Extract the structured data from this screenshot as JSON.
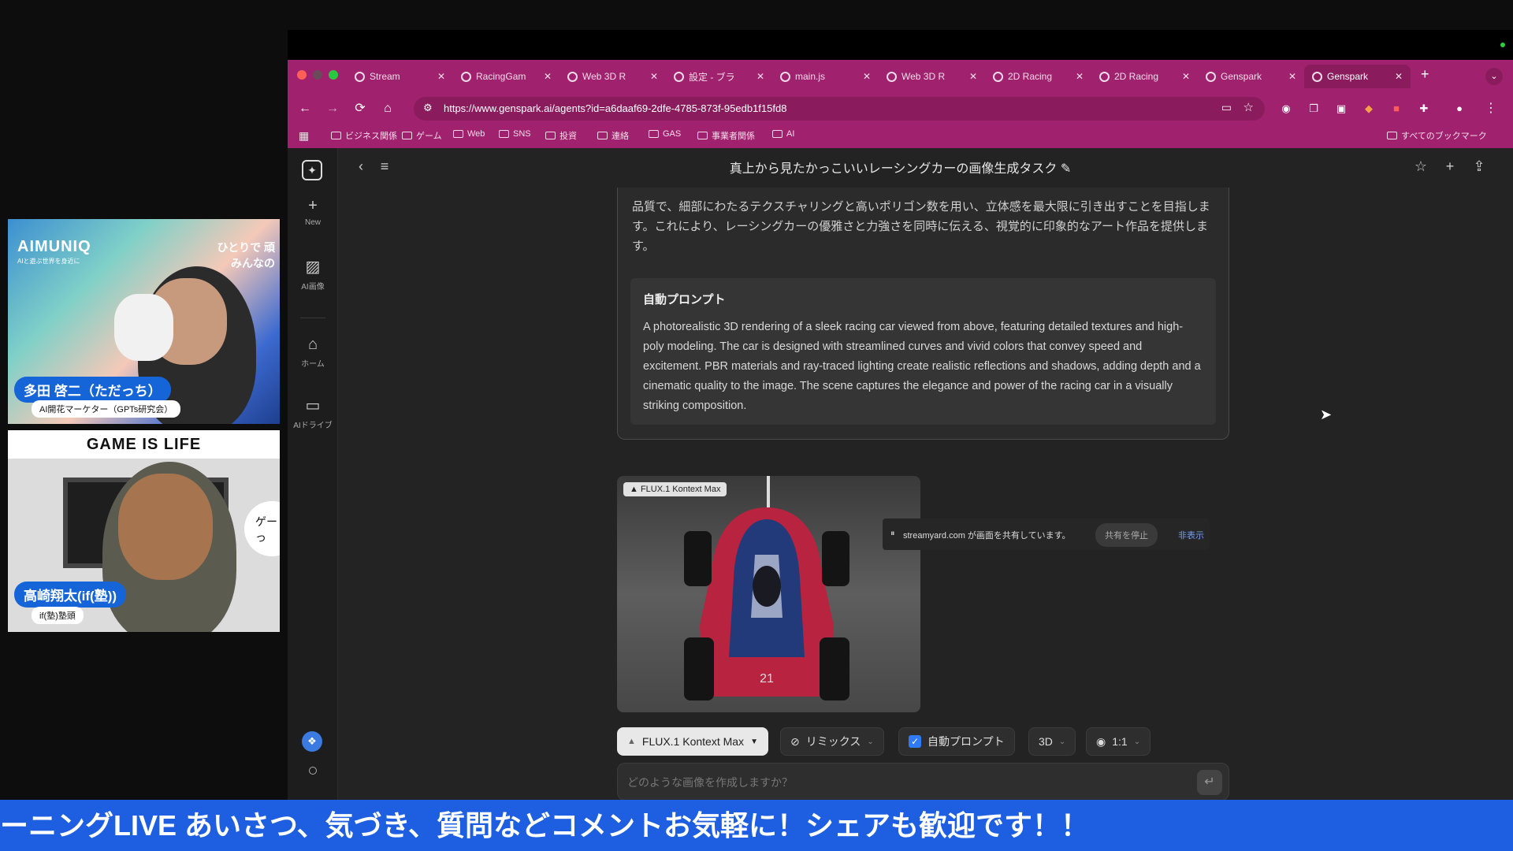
{
  "stream": {
    "cam1": {
      "brand": "AIMUNIQ",
      "brand_sub": "AIと遊ぶ世界を身近に",
      "tagline": "ひとりで 頑\nみんなの",
      "name": "多田 啓二（ただっち）",
      "role": "AI開花マーケター（GPTs研究会）"
    },
    "cam2": {
      "banner": "GAME IS LIFE",
      "speech": "ゲー 作っ",
      "name": "高崎翔太(if(塾))",
      "role": "if(塾)塾頭"
    },
    "ticker": "ーニングLIVE あいさつ、気づき、質問などコメントお気軽に！シェアも歓迎です！！"
  },
  "browser": {
    "tabs": [
      {
        "label": "Stream"
      },
      {
        "label": "RacingGam"
      },
      {
        "label": "Web 3D R"
      },
      {
        "label": "設定 - ブラ"
      },
      {
        "label": "main.js"
      },
      {
        "label": "Web 3D R"
      },
      {
        "label": "2D Racing"
      },
      {
        "label": "2D Racing"
      },
      {
        "label": "Genspark"
      },
      {
        "label": "Genspark"
      }
    ],
    "url": "https://www.genspark.ai/agents?id=a6daaf69-2dfe-4785-873f-95edb1f15fd8",
    "bookmarks": [
      "ビジネス関係",
      "ゲーム",
      "Web",
      "SNS",
      "投資",
      "連絡",
      "GAS",
      "事業者関係",
      "AI"
    ],
    "all_bookmarks": "すべてのブックマーク"
  },
  "app": {
    "sidebar": {
      "new": "New",
      "ai_image": "AI画像",
      "home": "ホーム",
      "ai_drive": "AIドライブ"
    },
    "header_title": "真上から見たかっこいいレーシングカーの画像生成タスク",
    "description": "品質で、細部にわたるテクスチャリングと高いポリゴン数を用い、立体感を最大限に引き出すことを目指します。これにより、レーシングカーの優雅さと力強さを同時に伝える、視覚的に印象的なアート作品を提供します。",
    "prompt_label": "自動プロンプト",
    "prompt_text": "A photorealistic 3D rendering of a sleek racing car viewed from above, featuring detailed textures and high-poly modeling. The car is designed with streamlined curves and vivid colors that convey speed and excitement. PBR materials and ray-traced lighting create realistic reflections and shadows, adding depth and a cinematic quality to the image. The scene captures the elegance and power of the racing car in a visually striking composition.",
    "image_badge": "FLUX.1 Kontext Max",
    "car_number": "21",
    "share_notice": "streamyard.com が画面を共有しています。",
    "share_stop": "共有を停止",
    "share_hide": "非表示",
    "chips": {
      "model": "FLUX.1 Kontext Max",
      "remix": "リミックス",
      "auto_prompt": "自動プロンプト",
      "style": "3D",
      "ratio": "1:1"
    },
    "input_placeholder": "どのような画像を作成しますか？"
  },
  "colors": {
    "tab_strip": "#a0226e",
    "ticker": "#1d5fe0",
    "name_tag": "#1565d8"
  }
}
